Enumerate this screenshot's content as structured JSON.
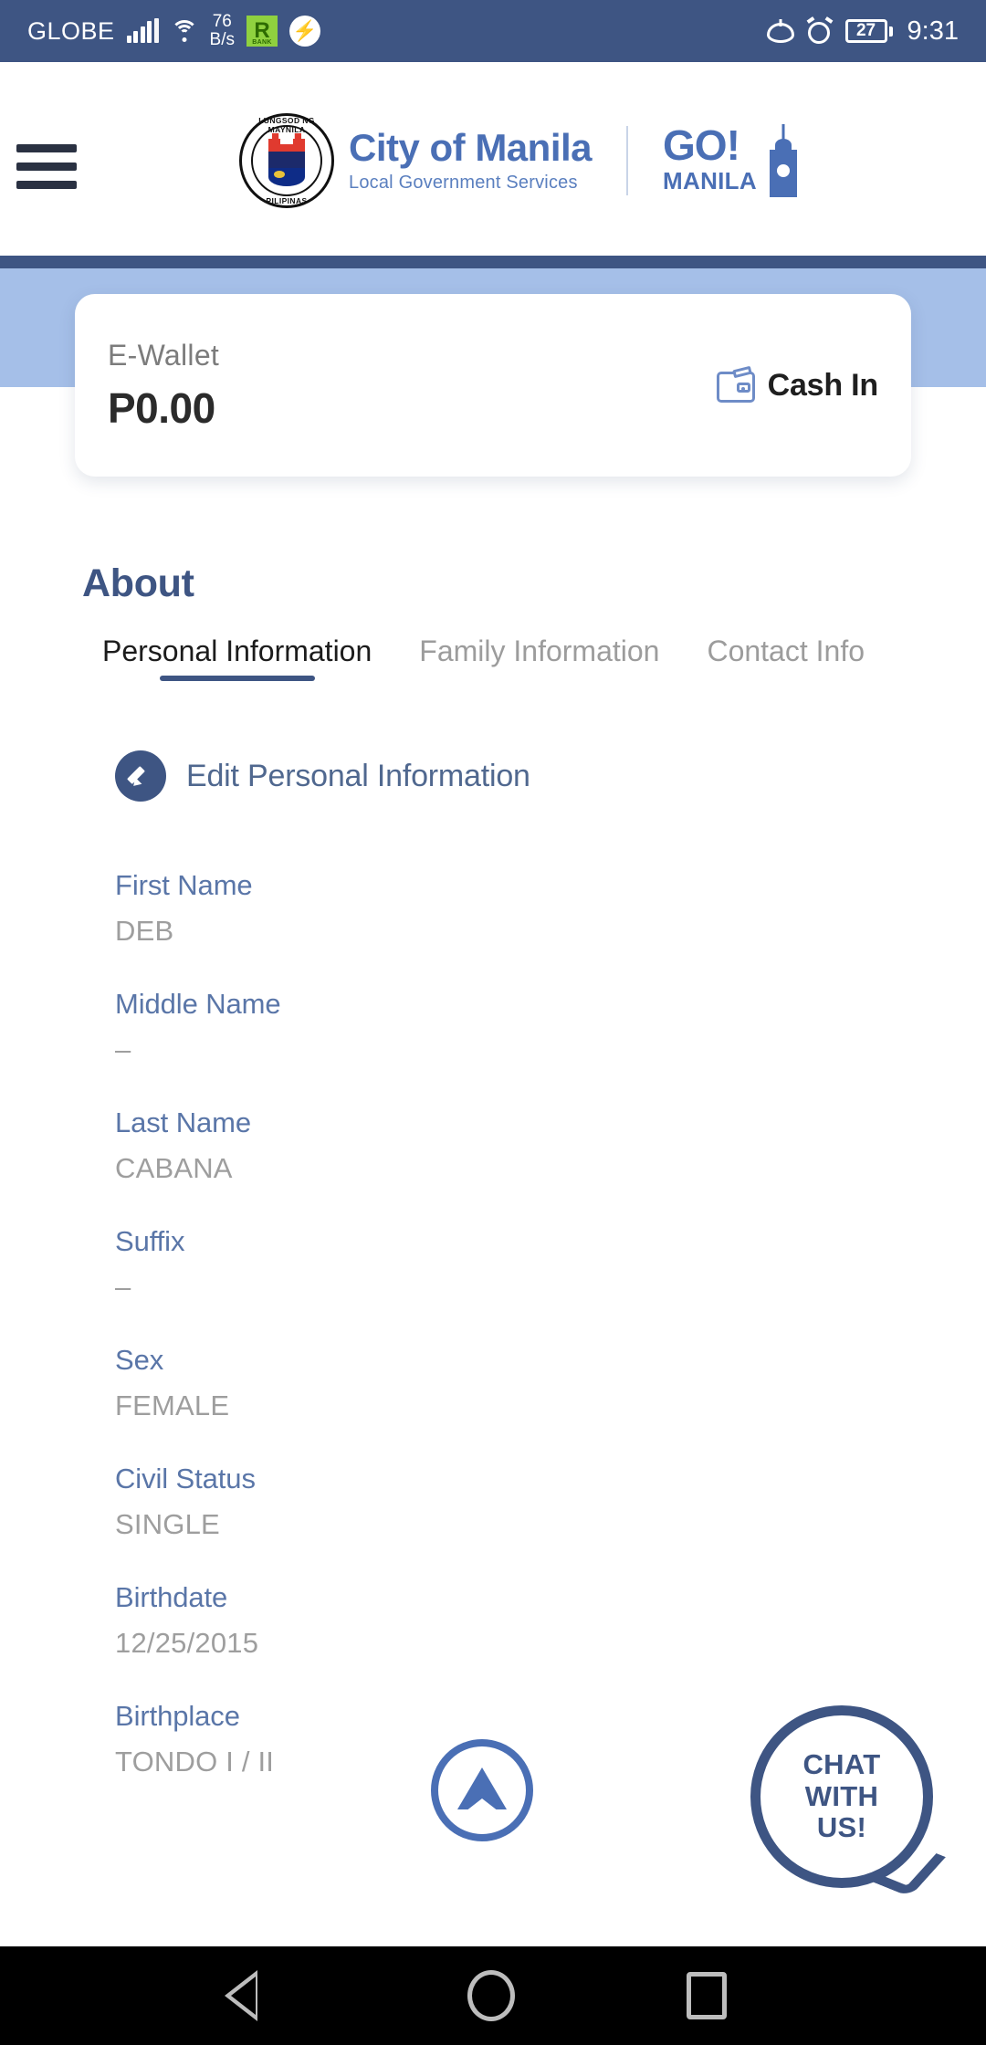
{
  "status_bar": {
    "carrier": "GLOBE",
    "network_speed": "76",
    "network_speed_unit": "B/s",
    "bank_badge": "R",
    "bank_badge_sub": "BANK",
    "messenger_icon": "messenger-icon",
    "eye_icon": "eye-care-icon",
    "alarm_icon": "alarm-icon",
    "battery_percent": "27",
    "time": "9:31",
    "background_color": "#3E5583"
  },
  "header": {
    "menu_icon": "hamburger-menu-icon",
    "seal_text_top": "LUNGSOD NG MAYNILA",
    "seal_text_bottom": "PILIPINAS",
    "brand_title": "City of Manila",
    "brand_subtitle": "Local Government Services",
    "go_label": "GO!",
    "manila_label": "MANILA",
    "accent_color": "#4A6FB5"
  },
  "wallet": {
    "label": "E-Wallet",
    "amount": "P0.00",
    "cash_in_label": "Cash In",
    "cash_in_icon": "wallet-icon",
    "banner_color": "#A5BFE8"
  },
  "about": {
    "title": "About",
    "tabs": [
      {
        "label": "Personal Information",
        "active": true
      },
      {
        "label": "Family Information",
        "active": false
      },
      {
        "label": "Contact Info",
        "active": false
      }
    ],
    "edit_action": {
      "label": "Edit Personal Information",
      "icon": "pencil-icon"
    },
    "fields": [
      {
        "label": "First Name",
        "value": "DEB"
      },
      {
        "label": "Middle Name",
        "value": "–"
      },
      {
        "label": "Last Name",
        "value": "CABANA"
      },
      {
        "label": "Suffix",
        "value": "–"
      },
      {
        "label": "Sex",
        "value": "FEMALE"
      },
      {
        "label": "Civil Status",
        "value": "SINGLE"
      },
      {
        "label": "Birthdate",
        "value": "12/25/2015"
      },
      {
        "label": "Birthplace",
        "value": "TONDO I / II"
      }
    ]
  },
  "floating": {
    "scroll_top_icon": "scroll-to-top-arrow-icon",
    "chat_line_1": "CHAT",
    "chat_line_2": "WITH",
    "chat_line_3": "US!",
    "chat_color": "#3E5583"
  },
  "navbar": {
    "back_icon": "back-triangle-icon",
    "home_icon": "home-circle-icon",
    "recents_icon": "recents-square-icon"
  }
}
